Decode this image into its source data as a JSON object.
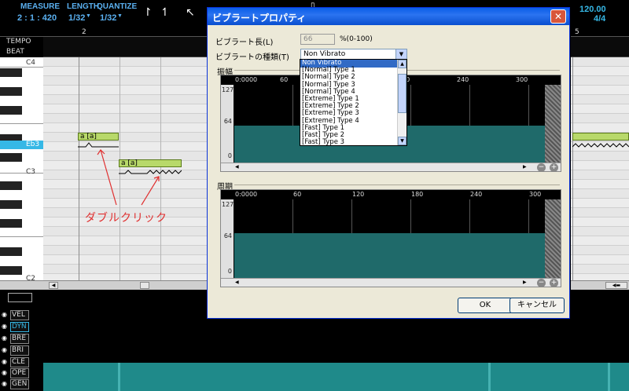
{
  "toolbar": {
    "measure_label": "MEASURE",
    "measure_value": "2 : 1 : 420",
    "length_label": "LENGTH",
    "length_value": "1/32",
    "quantize_label": "QUANTIZE",
    "quantize_value": "1/32",
    "tempo_value": "120.00",
    "beat_value": "4/4"
  },
  "ruler": {
    "bar2": "2",
    "bar5": "5"
  },
  "tracks": {
    "tempo": "TEMPO",
    "beat": "BEAT"
  },
  "piano": {
    "c4": "C4",
    "eb3": "Eb3",
    "c3": "C3",
    "c2": "C2"
  },
  "notes": [
    {
      "lyric": "a [a]"
    },
    {
      "lyric": "a [a]"
    }
  ],
  "annotation": "ダブルクリック",
  "controls": [
    "VEL",
    "DYN",
    "BRE",
    "BRI",
    "CLE",
    "OPE",
    "GEN"
  ],
  "dialog": {
    "title": "ビブラートプロパティ",
    "close": "✕",
    "length_label": "ビブラート長(L)",
    "length_value": "66",
    "length_range": "%(0-100)",
    "type_label": "ビブラートの種類(T)",
    "type_value": "Non Vibrato",
    "amplitude_label": "振幅",
    "period_label": "周期",
    "graph_origin": "0:0000",
    "graph_ticks": [
      "60",
      "120",
      "180",
      "240",
      "300"
    ],
    "y_labels": [
      "127",
      "64",
      "0"
    ],
    "ok": "OK",
    "cancel": "キャンセル"
  },
  "dropdown_options": [
    "Non Vibrato",
    "[Normal] Type 1",
    "[Normal] Type 2",
    "[Normal] Type 3",
    "[Normal] Type 4",
    "[Extreme] Type 1",
    "[Extreme] Type 2",
    "[Extreme] Type 3",
    "[Extreme] Type 4",
    "[Fast] Type 1",
    "[Fast] Type 2",
    "[Fast] Type 3"
  ],
  "colors": {
    "accent": "#36b8e6",
    "note": "#b8d96a",
    "teal": "#1f6a6a",
    "title_bar": "#0a5de8",
    "annotation": "#e03030"
  }
}
